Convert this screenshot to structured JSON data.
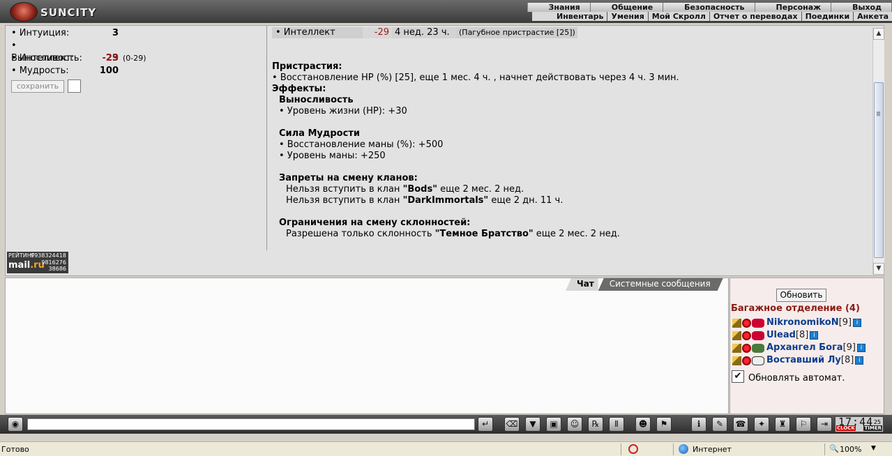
{
  "header": {
    "logo_text": "SUNCITY",
    "main_menu": [
      "Знания",
      "Общение",
      "Безопасность",
      "Персонаж",
      "Выход"
    ],
    "sub_menu": [
      "Инвентарь",
      "Умения",
      "Мой Скролл",
      "Отчет о переводах",
      "Поединки",
      "Анкета"
    ]
  },
  "stats": {
    "items": [
      {
        "label": "• Интуиция:",
        "value": "3"
      },
      {
        "label": "• Выносливость:",
        "value": "23"
      },
      {
        "label": "• Интеллект:",
        "value": "-29",
        "range": "(0-29)"
      },
      {
        "label": "• Мудрость:",
        "value": "100"
      }
    ],
    "save_label": "сохранить"
  },
  "rating": {
    "label": "РЕЙТИНГ",
    "num1": "9938324418",
    "brand": "mail",
    "brand_tld": ".ru",
    "num2": "9816276",
    "num3": "38686"
  },
  "effects": {
    "intel_row": {
      "name": "• Интеллект",
      "value": "-29",
      "duration": "4 нед. 23 ч.",
      "source": "(Пагубное пристрастие [25])"
    },
    "addictions_title": "Пристрастия:",
    "addiction_item": "• Восстановление HP (%) [25], еще 1 мес. 4 ч. , начнет действовать через 4 ч. 3 мин.",
    "effects_title": "Эффекты:",
    "endurance_title": "Выносливость",
    "endurance_item": "• Уровень жизни (HP): +30",
    "wisdom_title": "Сила Мудрости",
    "wisdom_item1": "• Восстановление маны (%): +500",
    "wisdom_item2": "• Уровень маны: +250",
    "clan_title": "Запреты на смену кланов:",
    "clan_line1_pre": "Нельзя вступить в клан ",
    "clan_line1_name": "\"Bods\"",
    "clan_line1_post": " еще 2 мес. 2 нед.",
    "clan_line2_pre": "Нельзя вступить в клан ",
    "clan_line2_name": "\"DarkImmortals\"",
    "clan_line2_post": " еще 2 дн. 11 ч.",
    "align_title": "Ограничения на смену склонностей:",
    "align_pre": "Разрешена только склонность ",
    "align_name": "\"Темное Братство\"",
    "align_post": " еще 2 мес. 2 нед."
  },
  "chat": {
    "tab_chat": "Чат",
    "tab_system": "Системные сообщения"
  },
  "online": {
    "refresh_label": "Обновить",
    "room_title": "Багажное отделение (4)",
    "users": [
      {
        "name": "NikronomikoN",
        "level": "[9]"
      },
      {
        "name": "Ulead",
        "level": "[8]"
      },
      {
        "name": "Архангел Бога",
        "level": "[9]"
      },
      {
        "name": "Воставший Лу",
        "level": "[8]"
      }
    ],
    "auto_label": "Обновлять автомат.",
    "auto_mark": "✔"
  },
  "toolbar": {
    "clock_time": "17:44",
    "clock_sec": "25",
    "clock_label": "CLOCK",
    "timer_label": "TIMER"
  },
  "statusbar": {
    "status": "Готово",
    "zone": "Интернет",
    "zoom": "100%"
  }
}
